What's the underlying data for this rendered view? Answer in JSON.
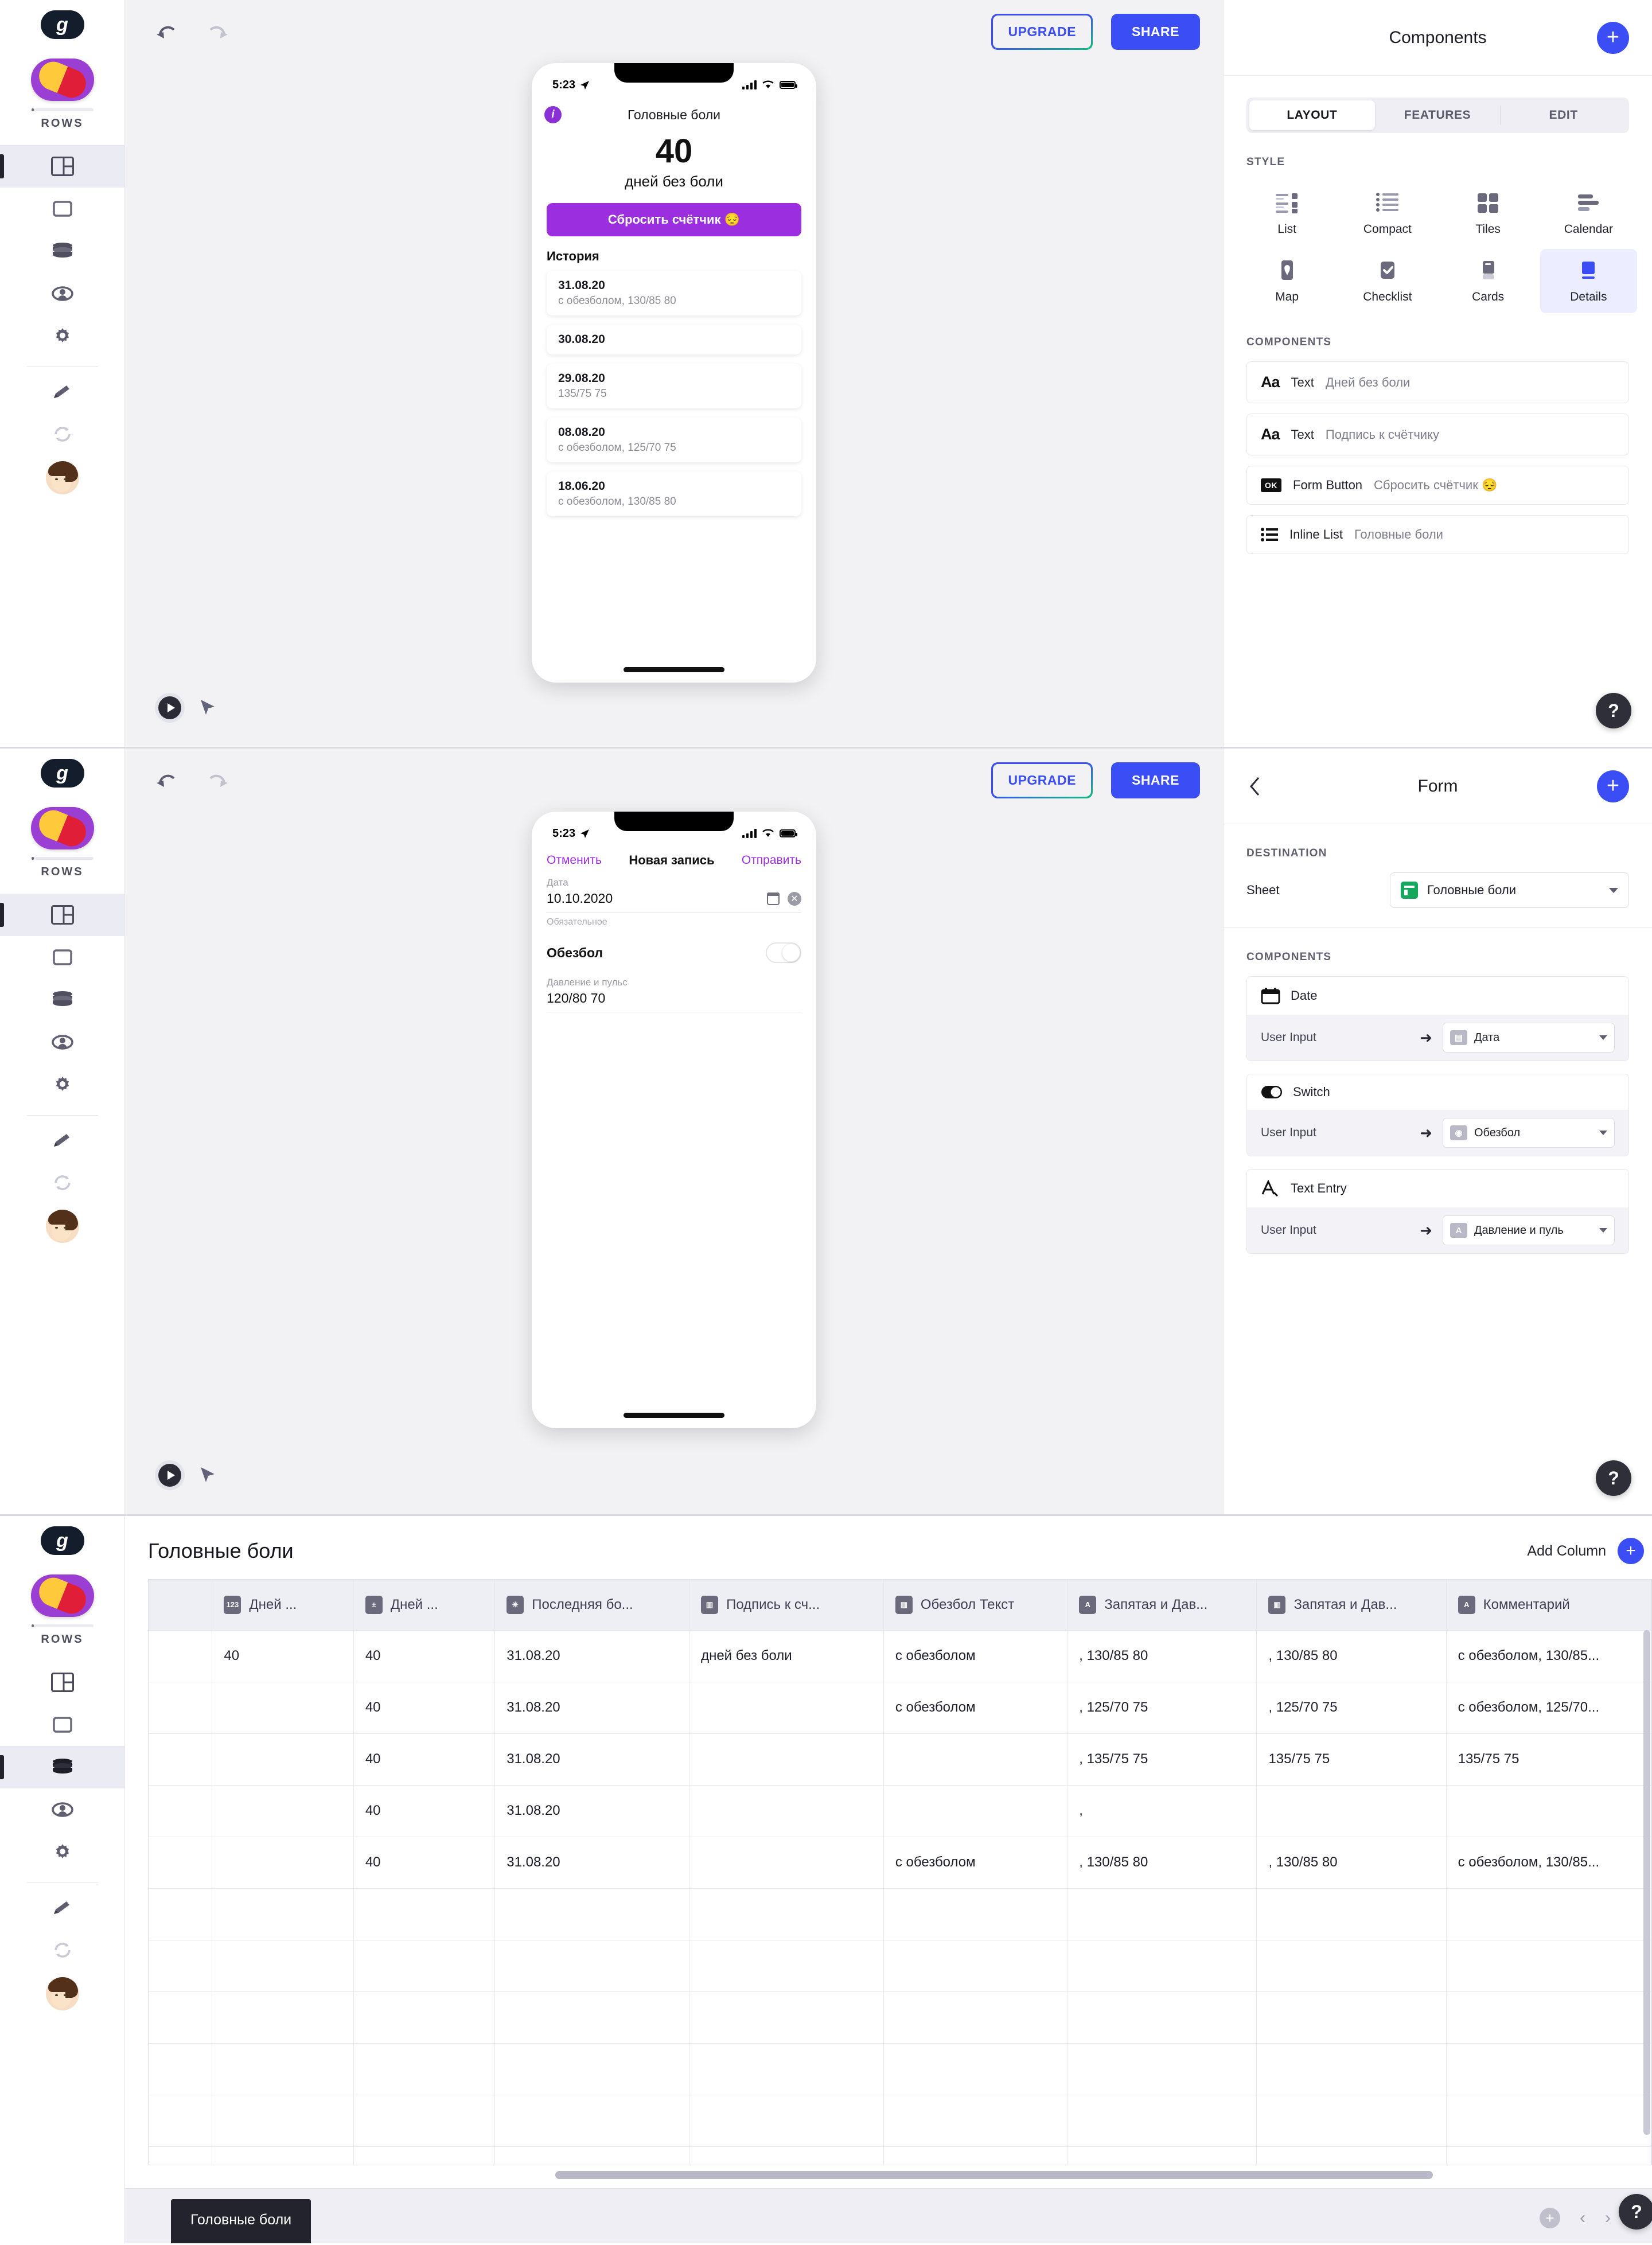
{
  "brand": {
    "logo_letter": "g",
    "product_name": "ROWS",
    "accent": "#3b4ef5",
    "app_purple": "#9b2fe0"
  },
  "toolbar": {
    "upgrade_label": "UPGRADE",
    "share_label": "SHARE"
  },
  "rail": {
    "items": [
      {
        "name": "layout",
        "icon": "layout-icon"
      },
      {
        "name": "screens",
        "icon": "screen-icon"
      },
      {
        "name": "data",
        "icon": "database-icon"
      },
      {
        "name": "users",
        "icon": "users-icon"
      },
      {
        "name": "settings",
        "icon": "gear-icon"
      },
      {
        "name": "edit",
        "icon": "pencil-icon"
      },
      {
        "name": "refresh",
        "icon": "refresh-icon"
      }
    ]
  },
  "panel1": {
    "phone": {
      "status_time": "5:23",
      "title": "Головные боли",
      "info_badge": "i",
      "counter": "40",
      "counter_label": "дней без боли",
      "reset_button": "Сбросить счётчик 😔",
      "history_heading": "История",
      "history": [
        {
          "date": "31.08.20",
          "sub": "с обезболом, 130/85 80"
        },
        {
          "date": "30.08.20",
          "sub": ""
        },
        {
          "date": "29.08.20",
          "sub": "135/75 75"
        },
        {
          "date": "08.08.20",
          "sub": "с обезболом, 125/70 75"
        },
        {
          "date": "18.06.20",
          "sub": "с обезболом, 130/85 80"
        }
      ]
    },
    "inspector": {
      "title": "Components",
      "tabs": [
        {
          "label": "LAYOUT",
          "active": true
        },
        {
          "label": "FEATURES",
          "active": false
        },
        {
          "label": "EDIT",
          "active": false
        }
      ],
      "style_label": "STYLE",
      "styles": [
        {
          "label": "List",
          "icon": "list-icon",
          "active": false
        },
        {
          "label": "Compact",
          "icon": "compact-icon",
          "active": false
        },
        {
          "label": "Tiles",
          "icon": "tiles-icon",
          "active": false
        },
        {
          "label": "Calendar",
          "icon": "calendar-icon",
          "active": false
        },
        {
          "label": "Map",
          "icon": "map-pin-icon",
          "active": false
        },
        {
          "label": "Checklist",
          "icon": "checklist-icon",
          "active": false
        },
        {
          "label": "Cards",
          "icon": "cards-icon",
          "active": false
        },
        {
          "label": "Details",
          "icon": "details-icon",
          "active": true
        }
      ],
      "components_label": "COMPONENTS",
      "components": [
        {
          "icon": "aa-text-icon",
          "type": "Text",
          "value": "Дней без боли"
        },
        {
          "icon": "aa-text-icon",
          "type": "Text",
          "value": "Подпись к счётчику"
        },
        {
          "icon": "ok-button-icon",
          "type": "Form Button",
          "value": "Сбросить счётчик 😔"
        },
        {
          "icon": "inline-list-icon",
          "type": "Inline List",
          "value": "Головные боли"
        }
      ],
      "help": "?"
    }
  },
  "panel2": {
    "phone": {
      "status_time": "5:23",
      "cancel_label": "Отменить",
      "title": "Новая запись",
      "submit_label": "Отправить",
      "date_label": "Дата",
      "date_value": "10.10.2020",
      "required_note": "Обязательное",
      "switch_label": "Обезбол",
      "text_label": "Давление и пульс",
      "text_value": "120/80 70"
    },
    "inspector": {
      "title": "Form",
      "destination_label": "DESTINATION",
      "sheet_label": "Sheet",
      "sheet_value": "Головные боли",
      "components_label": "COMPONENTS",
      "components": [
        {
          "icon": "calendar-icon",
          "name": "Date",
          "input_label": "User Input",
          "mapped_chip": "date-chip",
          "mapped_value": "Дата"
        },
        {
          "icon": "switch-icon",
          "name": "Switch",
          "input_label": "User Input",
          "mapped_chip": "switch-chip",
          "mapped_value": "Обезбол"
        },
        {
          "icon": "text-entry-icon",
          "name": "Text Entry",
          "input_label": "User Input",
          "mapped_chip": "text-chip",
          "mapped_value": "Давление и пуль"
        }
      ],
      "help": "?"
    }
  },
  "sheet": {
    "title": "Головные боли",
    "add_column_label": "Add Column",
    "tab_label": "Головные боли",
    "help": "?",
    "table": {
      "columns": [
        {
          "label": "Дней ...",
          "icon": "123"
        },
        {
          "label": "Дней ...",
          "icon": "fx"
        },
        {
          "label": "Последняя бо...",
          "icon": "*"
        },
        {
          "label": "Подпись к сч...",
          "icon": "fn"
        },
        {
          "label": "Обезбол Текст",
          "icon": "fn"
        },
        {
          "label": "Запятая и Дав...",
          "icon": "A"
        },
        {
          "label": "Запятая и Дав...",
          "icon": "fn"
        },
        {
          "label": "Комментарий",
          "icon": "A"
        }
      ],
      "rows": [
        [
          "40",
          "40",
          "31.08.20",
          "дней без боли",
          "с обезболом",
          ", 130/85 80",
          ", 130/85 80",
          "с обезболом, 130/85..."
        ],
        [
          "",
          "40",
          "31.08.20",
          "",
          "с обезболом",
          ", 125/70 75",
          ", 125/70 75",
          "с обезболом, 125/70..."
        ],
        [
          "",
          "40",
          "31.08.20",
          "",
          "",
          ", 135/75 75",
          "135/75 75",
          "135/75 75"
        ],
        [
          "",
          "40",
          "31.08.20",
          "",
          "",
          ",",
          "",
          ""
        ],
        [
          "",
          "40",
          "31.08.20",
          "",
          "с обезболом",
          ", 130/85 80",
          ", 130/85 80",
          "с обезболом, 130/85..."
        ],
        [
          "",
          "",
          "",
          "",
          "",
          "",
          "",
          ""
        ],
        [
          "",
          "",
          "",
          "",
          "",
          "",
          "",
          ""
        ],
        [
          "",
          "",
          "",
          "",
          "",
          "",
          "",
          ""
        ],
        [
          "",
          "",
          "",
          "",
          "",
          "",
          "",
          ""
        ],
        [
          "",
          "",
          "",
          "",
          "",
          "",
          "",
          ""
        ],
        [
          "",
          "",
          "",
          "",
          "",
          "",
          "",
          ""
        ]
      ]
    }
  }
}
